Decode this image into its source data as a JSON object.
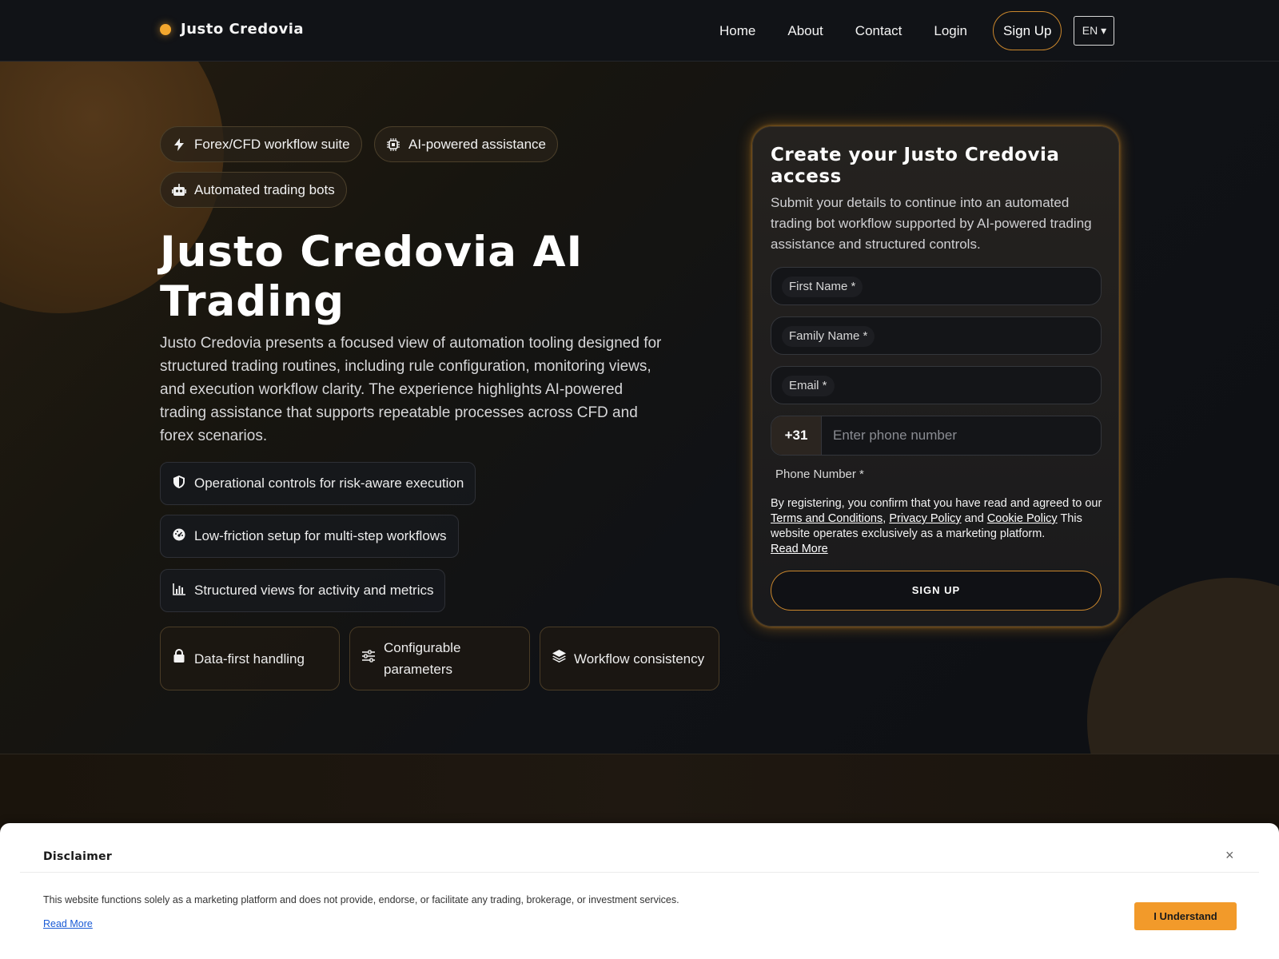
{
  "header": {
    "brand": "Justo Credovia",
    "nav": [
      {
        "label": "Home"
      },
      {
        "label": "About"
      },
      {
        "label": "Contact"
      },
      {
        "label": "Login"
      }
    ],
    "signup_label": "Sign Up",
    "language": "EN ▾"
  },
  "hero": {
    "pills": [
      {
        "label": "Forex/CFD workflow suite",
        "icon": "bolt-icon"
      },
      {
        "label": "AI-powered assistance",
        "icon": "chip-icon"
      },
      {
        "label": "Automated trading bots",
        "icon": "robot-icon"
      }
    ],
    "title": "Justo Credovia AI Trading",
    "description": "Justo Credovia presents a focused view of automation tooling designed for structured trading routines, including rule configuration, monitoring views, and execution workflow clarity. The experience highlights AI-powered trading assistance that supports repeatable processes across CFD and forex scenarios.",
    "features": [
      {
        "label": "Operational controls for risk-aware execution",
        "icon": "shield-icon"
      },
      {
        "label": "Low-friction setup for multi-step workflows",
        "icon": "gauge-icon"
      },
      {
        "label": "Structured views for activity and metrics",
        "icon": "bar-chart-icon"
      }
    ],
    "cards": [
      {
        "label": "Data-first handling",
        "icon": "lock-icon"
      },
      {
        "label": "Configurable parameters",
        "icon": "sliders-icon"
      },
      {
        "label": "Workflow consistency",
        "icon": "layers-icon"
      }
    ]
  },
  "form": {
    "title": "Create your Justo Credovia access",
    "subtitle": "Submit your details to continue into an automated trading bot workflow supported by AI-powered trading assistance and structured controls.",
    "first_name_label": "First Name *",
    "family_name_label": "Family Name *",
    "email_label": "Email *",
    "phone_code": "+31",
    "phone_placeholder": "Enter phone number",
    "phone_label": "Phone Number *",
    "consent_prefix": "By registering, you confirm that you have read and agreed to our",
    "terms_link": "Terms and Conditions",
    "privacy_link": "Privacy Policy",
    "and_text": "and",
    "cookie_link": "Cookie Policy",
    "consent_note": "This website operates exclusively as a marketing platform.",
    "read_more": "Read More",
    "submit_label": "SIGN UP"
  },
  "disclaimer": {
    "title": "Disclaimer",
    "close": "×",
    "text": "This website functions solely as a marketing platform and does not provide, endorse, or facilitate any trading, brokerage, or investment services.",
    "read_more": "Read More",
    "accept_label": "I Understand"
  },
  "colors": {
    "accent": "#f29a2a",
    "background": "#0e1014",
    "panel_glow": "#f3a02b"
  }
}
